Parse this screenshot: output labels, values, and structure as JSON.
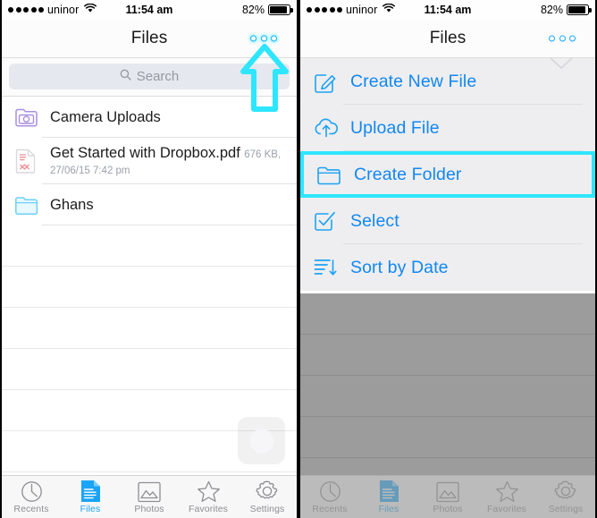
{
  "statusbar": {
    "carrier": "uninor",
    "time": "11:54 am",
    "battery_percent": "82%",
    "signal_dots": 5,
    "wifi_icon": "wifi-icon",
    "battery_icon": "battery-icon"
  },
  "navbar": {
    "title": "Files",
    "more_button_icon": "more-options-icon"
  },
  "search": {
    "placeholder": "Search",
    "icon": "search-icon"
  },
  "files": [
    {
      "name": "Camera Uploads",
      "meta": "",
      "icon": "camera-folder-icon"
    },
    {
      "name": "Get Started with Dropbox.pdf",
      "meta": "676 KB, 27/06/15 7:42 pm",
      "icon": "pdf-file-icon"
    },
    {
      "name": "Ghans",
      "meta": "",
      "icon": "folder-icon"
    }
  ],
  "menu": {
    "items": [
      {
        "label": "Create New File",
        "icon": "compose-icon",
        "highlighted": false
      },
      {
        "label": "Upload File",
        "icon": "cloud-upload-icon",
        "highlighted": false
      },
      {
        "label": "Create Folder",
        "icon": "folder-icon",
        "highlighted": true
      },
      {
        "label": "Select",
        "icon": "checkbox-check-icon",
        "highlighted": false
      },
      {
        "label": "Sort by Date",
        "icon": "sort-descending-icon",
        "highlighted": false
      }
    ]
  },
  "tabbar": {
    "items": [
      {
        "label": "Recents",
        "icon": "clock-icon",
        "active": false
      },
      {
        "label": "Files",
        "icon": "document-icon",
        "active": true
      },
      {
        "label": "Photos",
        "icon": "photo-icon",
        "active": false
      },
      {
        "label": "Favorites",
        "icon": "star-icon",
        "active": false
      },
      {
        "label": "Settings",
        "icon": "gear-icon",
        "active": false
      }
    ]
  },
  "annotations": {
    "arrow_icon": "up-arrow-annotation",
    "highlight_color": "#2EE6FF",
    "accent_color": "#1287F2"
  }
}
